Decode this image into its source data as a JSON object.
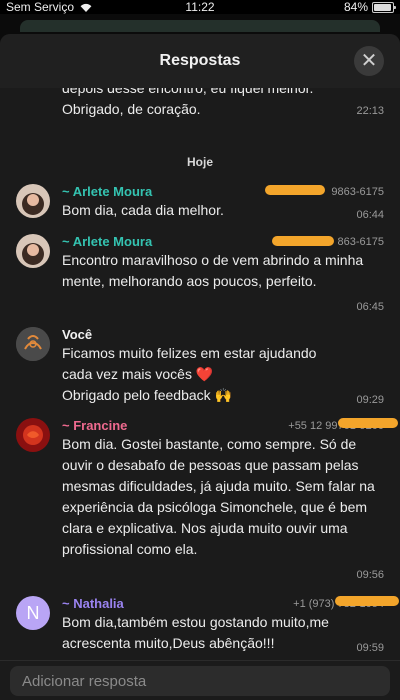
{
  "status_bar": {
    "carrier": "Sem Serviço",
    "time": "11:22",
    "battery": "84%",
    "battery_level": 0.84
  },
  "header": {
    "title": "Respostas"
  },
  "prior_message": {
    "text_line1": "depois desse encontro, eu fiquei melhor.",
    "text_line2": "Obrigado, de coração.",
    "time": "22:13"
  },
  "day_label": "Hoje",
  "messages": [
    {
      "name": "~ Arlete Moura",
      "phone": "9863-6175",
      "text": "Bom dia, cada dia melhor.",
      "time": "06:44",
      "name_color": "#34c3b1"
    },
    {
      "name": "~ Arlete Moura",
      "phone": "863-6175",
      "text": "Encontro maravilhoso  o de vem abrindo a minha mente, melhorando aos poucos, perfeito.",
      "time": "06:45",
      "name_color": "#34c3b1"
    },
    {
      "name": "Você",
      "phone": "",
      "text_line1": "Ficamos muito felizes em estar ajudando",
      "text_line2": "cada vez mais vocês ❤️",
      "text_line3": "Obrigado pelo feedback 🙌",
      "time": "09:29",
      "name_color": "#f1f1f1"
    },
    {
      "name": "~ Francine",
      "phone": "+55 12 99761-9200",
      "text": "Bom dia. Gostei bastante, como sempre. Só de ouvir o desabafo de pessoas que passam pelas mesmas dificuldades, já ajuda muito. Sem falar na experiência da psicóloga Simonchele, que é bem clara e explicativa. Nos ajuda muito ouvir uma profissional como ela.",
      "time": "09:56",
      "name_color": "#ef6a8f"
    },
    {
      "name": "~ Nathalia",
      "phone": "+1 (973) 732-1054",
      "text": "Bom dia,também estou gostando muito,me acrescenta muito,Deus abênção!!!",
      "time": "09:59",
      "name_color": "#9a83f0",
      "avatar_letter": "N"
    }
  ],
  "input": {
    "placeholder": "Adicionar resposta"
  },
  "colors": {
    "redaction": "#f3a52b",
    "background": "#1b1b1b"
  }
}
